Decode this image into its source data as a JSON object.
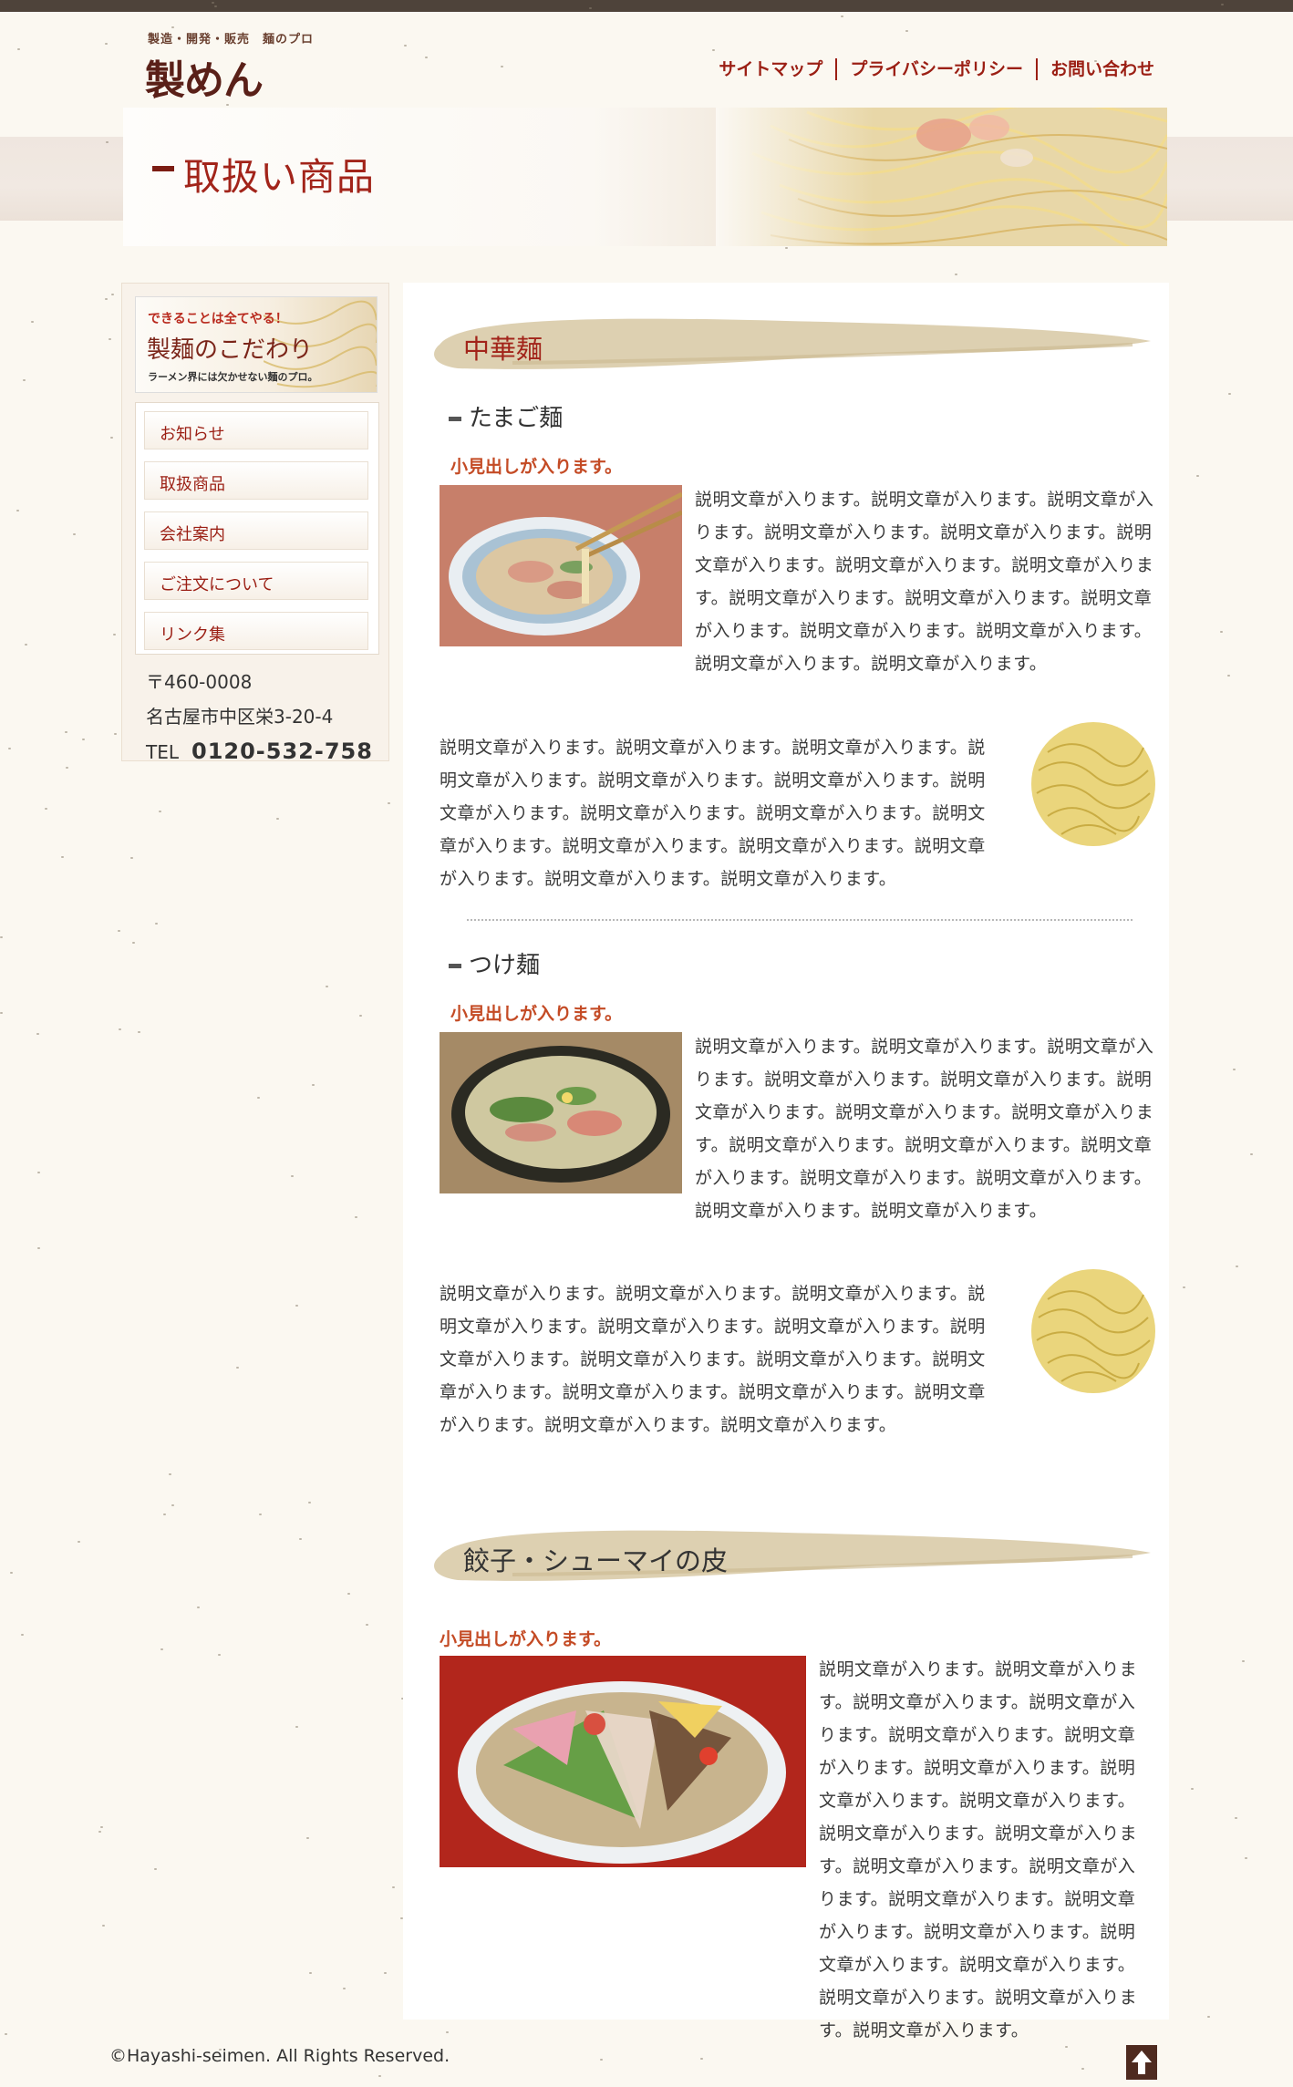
{
  "header": {
    "tagline": "製造・開発・販売　麺のプロ",
    "logo": "製めん",
    "nav": [
      "サイトマップ",
      "プライバシーポリシー",
      "お問い合わせ"
    ]
  },
  "page_title": "取扱い商品",
  "sidebar": {
    "banner": {
      "line1": "できることは全てやる！",
      "line2": "製麺のこだわり",
      "line3": "ラーメン界には欠かせない麺のプロ。"
    },
    "menu": [
      "お知らせ",
      "取扱商品",
      "会社案内",
      "ご注文について",
      "リンク集"
    ],
    "address": {
      "zip": "〒460-0008",
      "street": "名古屋市中区栄3-20-4",
      "tel_label": "TEL",
      "tel": "0120-532-758"
    }
  },
  "main": {
    "categories": [
      {
        "title": "中華麺",
        "products": [
          {
            "name": "たまご麺",
            "subheading": "小見出しが入ります。",
            "text_a": "説明文章が入ります。説明文章が入ります。説明文章が入ります。説明文章が入ります。説明文章が入ります。説明文章が入ります。説明文章が入ります。説明文章が入ります。説明文章が入ります。説明文章が入ります。説明文章が入ります。説明文章が入ります。説明文章が入ります。説明文章が入ります。説明文章が入ります。",
            "text_b": "説明文章が入ります。説明文章が入ります。説明文章が入ります。説明文章が入ります。説明文章が入ります。説明文章が入ります。説明文章が入ります。説明文章が入ります。説明文章が入ります。説明文章が入ります。説明文章が入ります。説明文章が入ります。説明文章が入ります。説明文章が入ります。説明文章が入ります。"
          },
          {
            "name": "つけ麺",
            "subheading": "小見出しが入ります。",
            "text_a": "説明文章が入ります。説明文章が入ります。説明文章が入ります。説明文章が入ります。説明文章が入ります。説明文章が入ります。説明文章が入ります。説明文章が入ります。説明文章が入ります。説明文章が入ります。説明文章が入ります。説明文章が入ります。説明文章が入ります。説明文章が入ります。説明文章が入ります。",
            "text_b": "説明文章が入ります。説明文章が入ります。説明文章が入ります。説明文章が入ります。説明文章が入ります。説明文章が入ります。説明文章が入ります。説明文章が入ります。説明文章が入ります。説明文章が入ります。説明文章が入ります。説明文章が入ります。説明文章が入ります。説明文章が入ります。説明文章が入ります。"
          }
        ]
      },
      {
        "title": "餃子・シューマイの皮",
        "subheading": "小見出しが入ります。",
        "text": "説明文章が入ります。説明文章が入ります。説明文章が入ります。説明文章が入ります。説明文章が入ります。説明文章が入ります。説明文章が入ります。説明文章が入ります。説明文章が入ります。説明文章が入ります。説明文章が入ります。説明文章が入ります。説明文章が入ります。説明文章が入ります。説明文章が入ります。説明文章が入ります。説明文章が入ります。説明文章が入ります。説明文章が入ります。説明文章が入ります。説明文章が入ります。"
      }
    ]
  },
  "footer": {
    "copyright": "©Hayashi-seimen. All Rights Reserved."
  },
  "colors": {
    "accent": "#9b1f14",
    "title": "#a2241a",
    "subheading": "#c44b25",
    "topbar": "#4e433a",
    "background": "#fbf8f1"
  }
}
